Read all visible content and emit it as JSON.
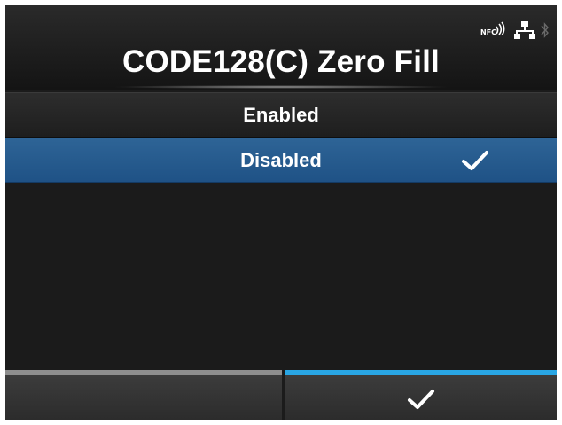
{
  "header": {
    "title": "CODE128(C) Zero Fill",
    "status_icons": {
      "nfc_label": "NFC",
      "nfc": "nfc-wireless-icon",
      "lan": "lan-network-icon",
      "bluetooth": "bluetooth-icon"
    }
  },
  "options": [
    {
      "label": "Enabled",
      "selected": false
    },
    {
      "label": "Disabled",
      "selected": true,
      "check_icon": "checkmark-icon"
    }
  ],
  "softkeys": {
    "left": {
      "label": ""
    },
    "right": {
      "icon": "checkmark-icon"
    }
  },
  "colors": {
    "background": "#1b1b1b",
    "selected_row": "#2a5d92",
    "left_softkey_bar": "#8e8e8e",
    "right_softkey_bar": "#29a6e4"
  }
}
